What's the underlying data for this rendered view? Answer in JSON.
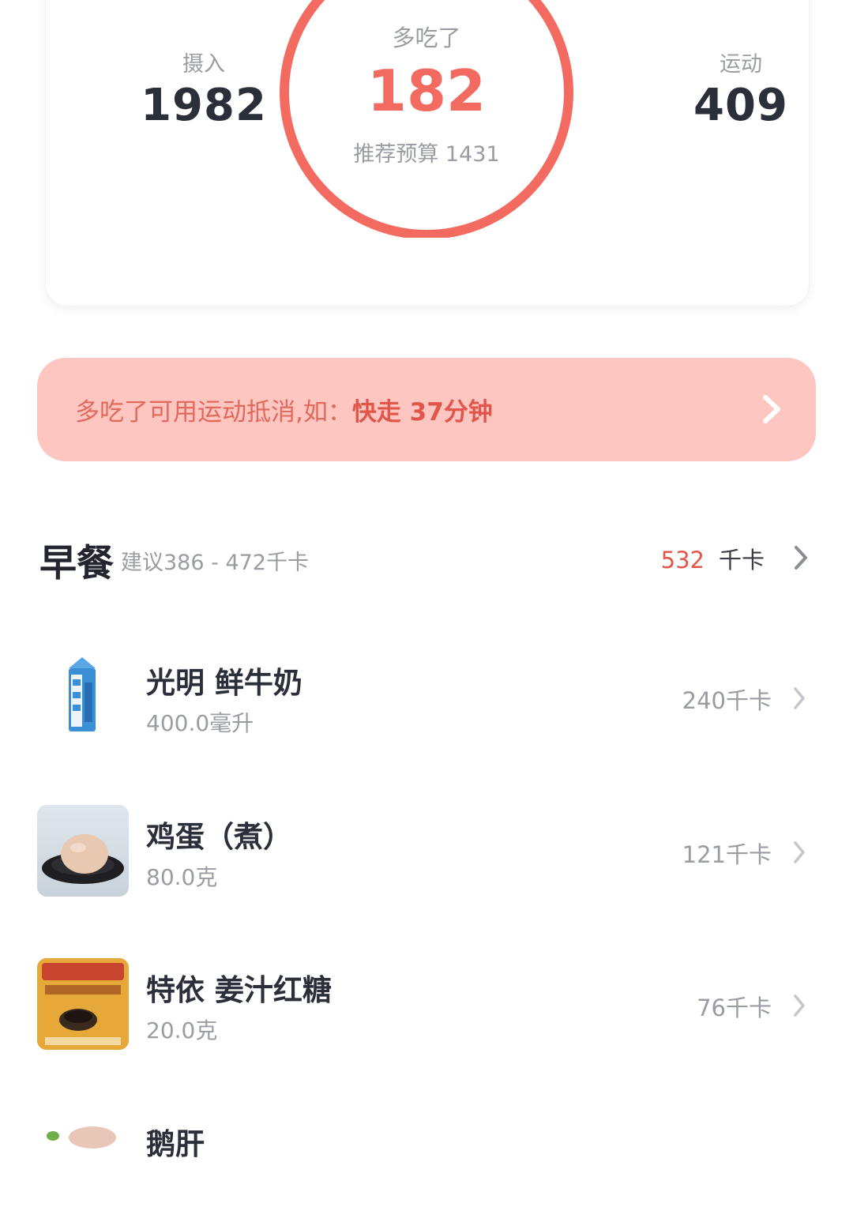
{
  "summary": {
    "intake": {
      "label": "摄入",
      "value": "1982"
    },
    "over": {
      "label": "多吃了",
      "value": "182",
      "budget": "推荐预算 1431"
    },
    "exercise": {
      "label": "运动",
      "value": "409"
    }
  },
  "tip": {
    "text": "多吃了可用运动抵消,如：",
    "highlight": "快走 37分钟"
  },
  "meal": {
    "title": "早餐",
    "suggest": "建议386 - 472千卡",
    "kcal": "532",
    "unit": "千卡"
  },
  "foods": [
    {
      "name": "光明 鲜牛奶",
      "qty": "400.0毫升",
      "kcal": "240千卡"
    },
    {
      "name": "鸡蛋（煮）",
      "qty": "80.0克",
      "kcal": "121千卡"
    },
    {
      "name": "特依 姜汁红糖",
      "qty": "20.0克",
      "kcal": "76千卡"
    },
    {
      "name": "鹅肝"
    }
  ],
  "colors": {
    "accent": "#f36b60",
    "banner_bg": "#fdc6c0"
  }
}
